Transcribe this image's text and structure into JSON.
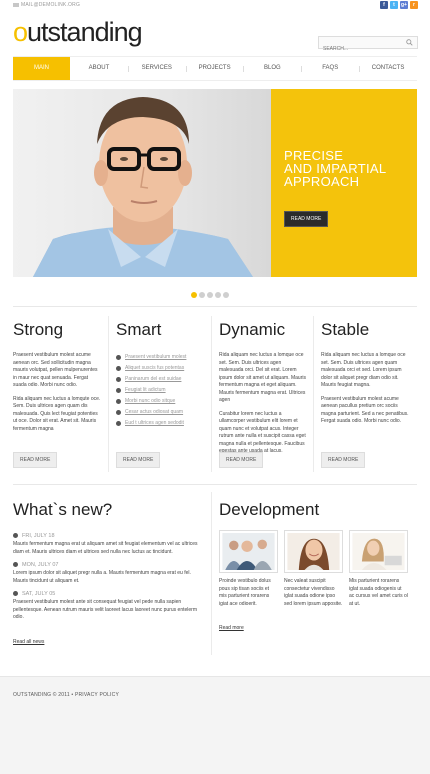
{
  "header": {
    "email": "MAIL@DEMOLINK.ORG",
    "logo_o": "o",
    "logo_rest": "utstanding",
    "search_placeholder": "SEARCH...",
    "social": [
      {
        "icon": "facebook-icon",
        "label": "f",
        "color": "#3b5998"
      },
      {
        "icon": "twitter-icon",
        "label": "t",
        "color": "#4ab3f4"
      },
      {
        "icon": "google-plus-icon",
        "label": "g+",
        "color": "#5d7dd4"
      },
      {
        "icon": "rss-icon",
        "label": "r",
        "color": "#f7931e"
      }
    ]
  },
  "nav": [
    "MAIN",
    "ABOUT",
    "SERVICES",
    "PROJECTS",
    "BLOG",
    "FAQS",
    "CONTACTS"
  ],
  "hero": {
    "line1": "PRECISE",
    "line2": "AND IMPARTIAL",
    "line3": "APPROACH",
    "button": "READ MORE",
    "slides": 5,
    "active_slide": 1
  },
  "columns": [
    {
      "title": "Strong",
      "p1": "Praesent vestibulum molest acume aenean orc. Sed sollicitudin magna mauris volutpat, pellen mulpenurentes in maur nec quat senuada. Fergat suada odio. Morbi nunc odio.",
      "p2": "Rida aliquam nec luctus a lomqute oce. Sem. Duis ultrices agen quam dis malesuada. Quis lect feugiat potenties ut oce. Dolor sit erat. Amet sit. Mauris fermentum magna",
      "button": "READ MORE"
    },
    {
      "title": "Smart",
      "items": [
        "Praesent vestibulum molest",
        "Aliquet suscis fus potentas",
        "Paninarum del est suidae",
        "Feugiat lit adictum",
        "Morbi nunc odio sitque",
        "Cesar actus odiosat quam",
        "Eud t ultrices agen sedodit"
      ],
      "button": "READ MORE"
    },
    {
      "title": "Dynamic",
      "p1": "Rida aliquam nec luctus a lomque oce set. Sem. Duis ultrices agen malesuada orci. Del sit erat. Lorem ipsum dolor sit amet ut aliquam. Mauris fermentum magna et eget aliquam. Mauris fermentum magna erat. Ultrices agen",
      "p2": "Curabitur lorem nec luctus a ullamcorper vestibulum elit lorem et quam nunc et volutpat acus. Integer rutrum ante nulla et suscipit cassa eget magna nulla et pellentesque. Faucibus egestas ante usada at lacus.",
      "button": "READ MORE"
    },
    {
      "title": "Stable",
      "p1": "Rida aliquam nec luctus a lomque oce set. Sem. Duis ultrices agen quam malesuada orci et sed. Lorem ipsum dolor sit aliquet pregr diam odio sit. Mauris feugiat magna.",
      "p2": "Praesent vestibulum molest acume aenean pacullus pretium orc sociis magna parturient. Sed a nec penatibus. Fergat suada odio. Morbi nunc odio.",
      "button": "READ MORE"
    }
  ],
  "whats_new": {
    "title": "What`s new?",
    "items": [
      {
        "date": "FRI, JULY 18",
        "text": "Mauris fermentum magna erat ut aliquam amet sit feugiat elementum vel ac ultrices diam et. Mauris ultrices diam et ultrices sed nulla nec luctus ac tincidunt."
      },
      {
        "date": "MON, JULY 07",
        "text": "Lorem ipsum dolor sit aliquet pregr nulla a. Mauris fermentum magna erat eu fel. Mauris tincidunt ut aliquam et."
      },
      {
        "date": "SAT, JULY 05",
        "text": "Praesent vestibulum molest ante sit consequat feugiat vel pede nulla sapien pellentesque. Aenean rutrum mauris velit laoreet lacus laoreet nunc purus entelerm odio."
      }
    ],
    "read_all": "Read all news"
  },
  "development": {
    "title": "Development",
    "texts": [
      "Proinde vestibulo dolus pous sip tisan sociis et mis parturient rorarens igiat ace odioerit.",
      "Nec valeat suscipit consectetur vivendisso iglat suada odione ipso sed lorem ipsum apposite.",
      "Mis parturient rorarens iglat suada odiogenis ut ac cursus vel amet curis ol at ut."
    ],
    "read_more": "Read more"
  },
  "footer": {
    "text": "OUTSTANDING © 2011 • PRIVACY POLICY"
  }
}
